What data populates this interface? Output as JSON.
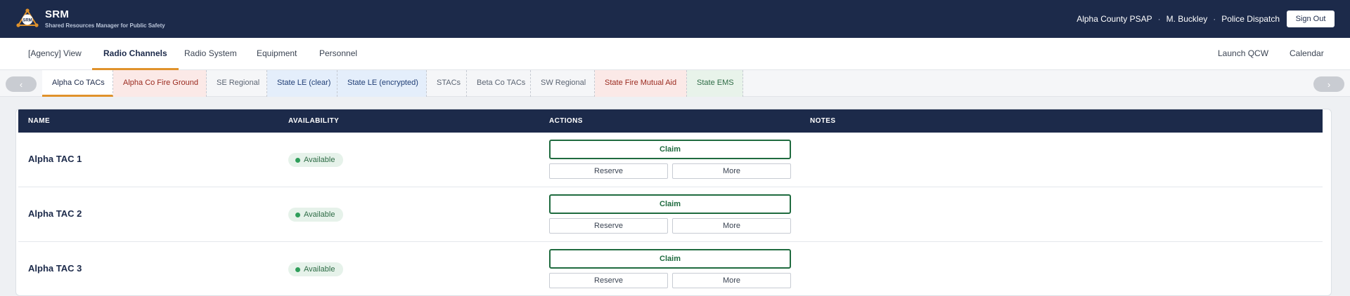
{
  "header": {
    "brand_title": "SRM",
    "brand_subtitle": "Shared Resources Manager for Public Safety",
    "org": "Alpha County PSAP",
    "user": "M. Buckley",
    "role": "Police Dispatch",
    "separator": "·",
    "signout_label": "Sign Out",
    "logo_text": "SRM"
  },
  "nav": {
    "items": [
      {
        "label": "[Agency] View",
        "active": false
      },
      {
        "label": "Radio Channels",
        "active": true
      },
      {
        "label": "Radio System",
        "active": false
      },
      {
        "label": "Equipment",
        "active": false
      },
      {
        "label": "Personnel",
        "active": false
      }
    ],
    "right_items": [
      {
        "label": "Launch QCW"
      },
      {
        "label": "Calendar"
      }
    ]
  },
  "channel_tabs": {
    "prev_icon": "‹",
    "next_icon": "›",
    "items": [
      {
        "label": "Alpha Co TACs",
        "active": true,
        "bg": "#ffffff",
        "color": "#1c2a4a"
      },
      {
        "label": "Alpha Co Fire Ground",
        "active": false,
        "bg": "#fbe9e7",
        "color": "#9a2a1f"
      },
      {
        "label": "SE Regional",
        "active": false,
        "bg": "#f5f6f8",
        "color": "#5b6472"
      },
      {
        "label": "State LE (clear)",
        "active": false,
        "bg": "#e4eefb",
        "color": "#1f3d75"
      },
      {
        "label": "State LE (encrypted)",
        "active": false,
        "bg": "#e4eefb",
        "color": "#1f3d75"
      },
      {
        "label": "STACs",
        "active": false,
        "bg": "#f5f6f8",
        "color": "#5b6472"
      },
      {
        "label": "Beta Co TACs",
        "active": false,
        "bg": "#f5f6f8",
        "color": "#5b6472"
      },
      {
        "label": "SW Regional",
        "active": false,
        "bg": "#f5f6f8",
        "color": "#5b6472"
      },
      {
        "label": "State Fire Mutual Aid",
        "active": false,
        "bg": "#fbe9e7",
        "color": "#9a2a1f"
      },
      {
        "label": "State EMS",
        "active": false,
        "bg": "#e8f3ea",
        "color": "#2d6b45"
      }
    ]
  },
  "table": {
    "columns": [
      "NAME",
      "AVAILABILITY",
      "ACTIONS",
      "NOTES"
    ],
    "rows": [
      {
        "name": "Alpha TAC 1",
        "availability": "Available",
        "claim": "Claim",
        "reserve": "Reserve",
        "more": "More",
        "notes": ""
      },
      {
        "name": "Alpha TAC 2",
        "availability": "Available",
        "claim": "Claim",
        "reserve": "Reserve",
        "more": "More",
        "notes": ""
      },
      {
        "name": "Alpha TAC 3",
        "availability": "Available",
        "claim": "Claim",
        "reserve": "Reserve",
        "more": "More",
        "notes": ""
      }
    ]
  },
  "colors": {
    "header_bg": "#1c2a4a",
    "accent": "#e0922b",
    "available": "#2f9e5a",
    "claim": "#1f6b3f"
  }
}
